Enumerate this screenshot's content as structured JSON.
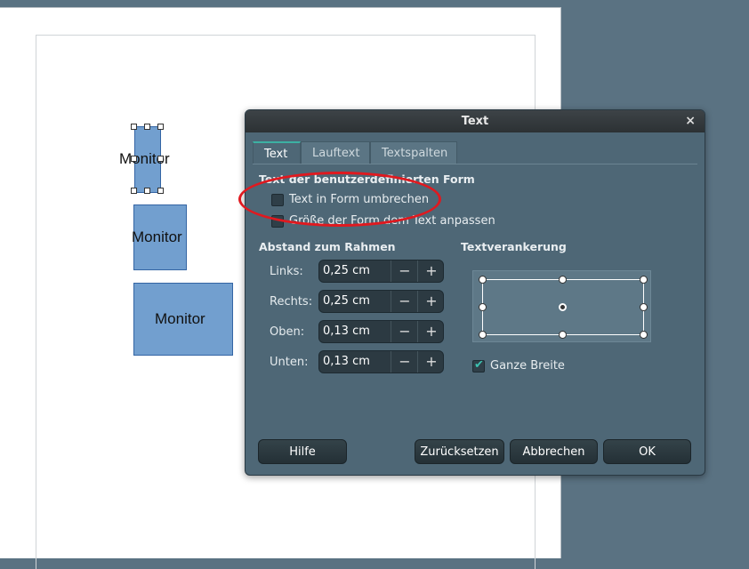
{
  "document": {
    "shapes": [
      {
        "label": "Monitor"
      },
      {
        "label": "Monitor"
      },
      {
        "label": "Monitor"
      }
    ]
  },
  "dialog": {
    "title": "Text",
    "close_glyph": "×",
    "tabs": [
      {
        "label": "Text",
        "active": true
      },
      {
        "label": "Lauftext",
        "active": false
      },
      {
        "label": "Textspalten",
        "active": false
      }
    ],
    "shape_text_section": {
      "title": "Text der benutzerdefinierten Form",
      "options": [
        {
          "label": "Text in Form umbrechen",
          "checked": false
        },
        {
          "label": "Größe der Form dem Text anpassen",
          "checked": false
        }
      ]
    },
    "spacing_section": {
      "title": "Abstand zum Rahmen",
      "fields": [
        {
          "label": "Links:",
          "value": "0,25 cm"
        },
        {
          "label": "Rechts:",
          "value": "0,25 cm"
        },
        {
          "label": "Oben:",
          "value": "0,13 cm"
        },
        {
          "label": "Unten:",
          "value": "0,13 cm"
        }
      ],
      "minus_glyph": "−",
      "plus_glyph": "+"
    },
    "anchor_section": {
      "title": "Textverankerung",
      "full_width": {
        "label": "Ganze Breite",
        "checked": true
      }
    },
    "buttons": {
      "help": "Hilfe",
      "reset": "Zurücksetzen",
      "cancel": "Abbrechen",
      "ok": "OK"
    }
  },
  "colors": {
    "shape_fill": "#729fcf",
    "dialog_bg": "#4e6776",
    "annotation": "#e0191f",
    "accent": "#3cb0a3"
  }
}
